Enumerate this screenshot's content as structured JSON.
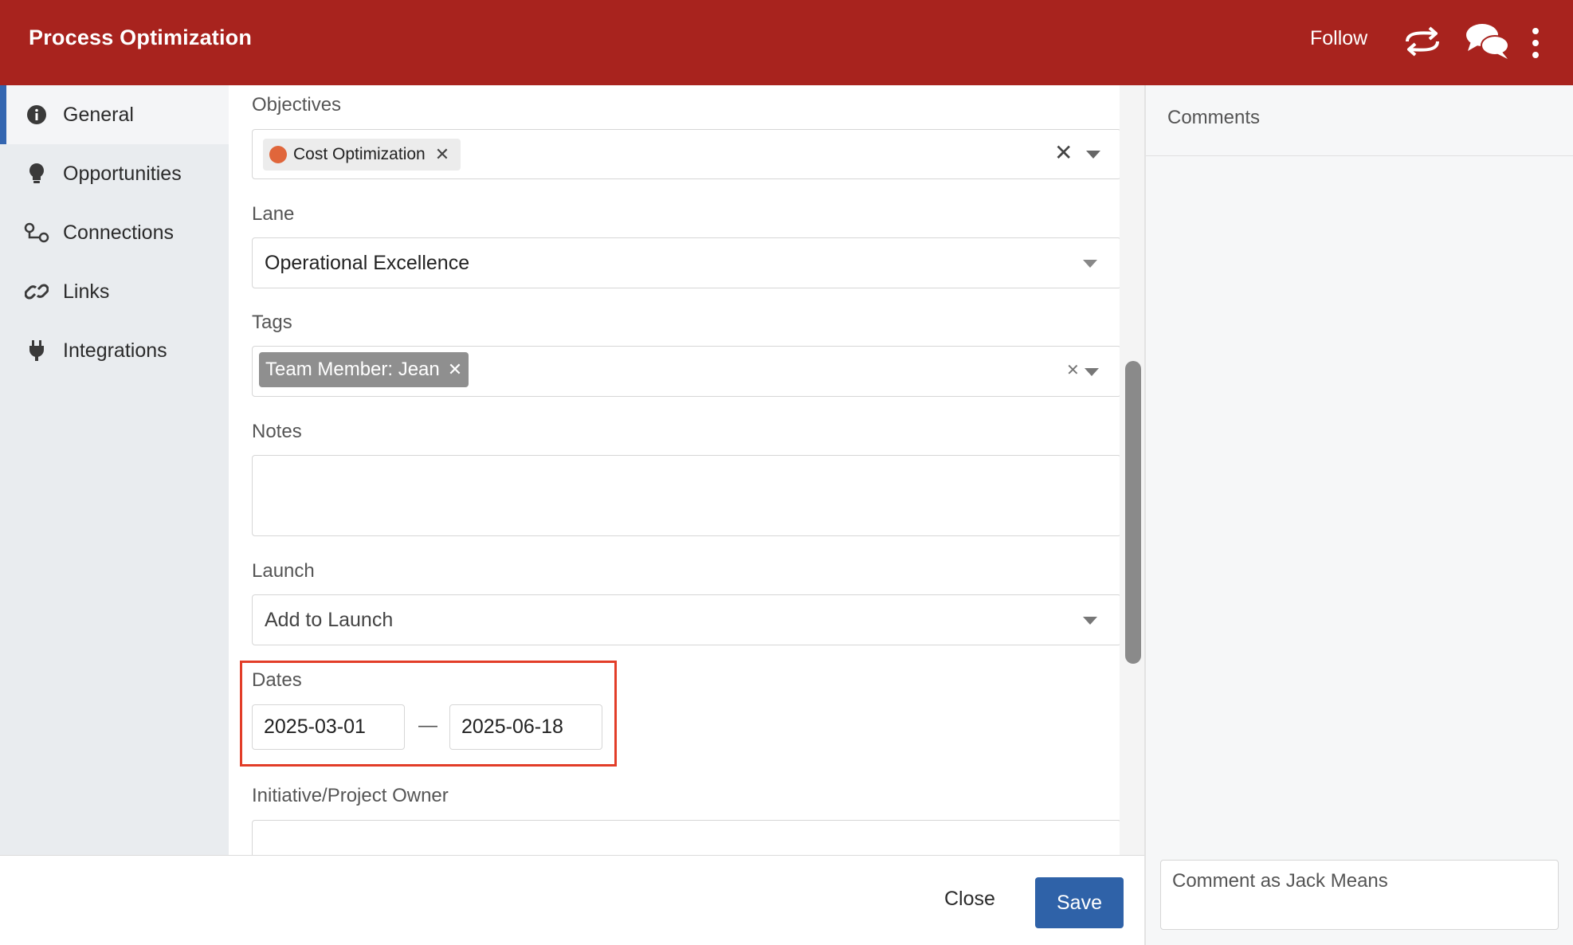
{
  "header": {
    "title": "Process Optimization",
    "follow_label": "Follow",
    "icons": [
      "sync-icon",
      "chat-icon",
      "more-vertical-icon"
    ],
    "color": "#a8231e"
  },
  "sidebar": {
    "items": [
      {
        "label": "General",
        "icon": "info-icon",
        "active": true
      },
      {
        "label": "Opportunities",
        "icon": "lightbulb-icon",
        "active": false
      },
      {
        "label": "Connections",
        "icon": "connections-icon",
        "active": false
      },
      {
        "label": "Links",
        "icon": "link-icon",
        "active": false
      },
      {
        "label": "Integrations",
        "icon": "plug-icon",
        "active": false
      }
    ]
  },
  "form": {
    "objectives": {
      "label": "Objectives",
      "chip": "Cost Optimization",
      "chip_color": "#e0663b"
    },
    "lane": {
      "label": "Lane",
      "value": "Operational Excellence"
    },
    "tags": {
      "label": "Tags",
      "chip": "Team Member: Jean"
    },
    "notes": {
      "label": "Notes",
      "value": ""
    },
    "launch": {
      "label": "Launch",
      "placeholder": "Add to Launch"
    },
    "dates": {
      "label": "Dates",
      "start": "2025-03-01",
      "separator": "—",
      "end": "2025-06-18"
    },
    "owner": {
      "label": "Initiative/Project Owner",
      "value": ""
    }
  },
  "footer": {
    "close_label": "Close",
    "save_label": "Save",
    "save_color": "#2f62a8"
  },
  "comments": {
    "title": "Comments",
    "placeholder": "Comment as Jack Means"
  },
  "highlight_color": "#e23d28"
}
